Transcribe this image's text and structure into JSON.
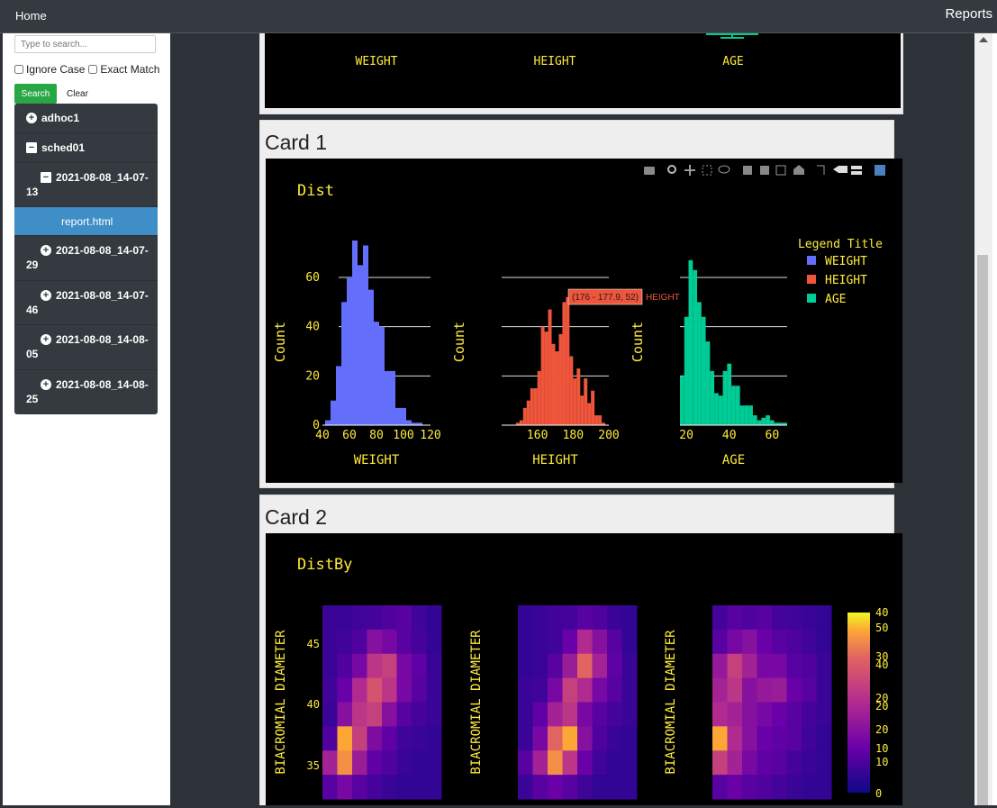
{
  "navbar": {
    "home": "Home",
    "reports": "Reports"
  },
  "sidebar": {
    "search_placeholder": "Type to search...",
    "ignore_case": "Ignore Case",
    "exact_match": "Exact Match",
    "search_button": "Search",
    "clear_button": "Clear",
    "tree": [
      {
        "label": "adhoc1",
        "icon": "plus-circle-icon"
      },
      {
        "label": "sched01",
        "icon": "minus-square-icon"
      },
      {
        "label": "2021-08-08_14-07-13",
        "icon": "minus-square-icon"
      },
      {
        "label": "report.html",
        "active": true
      },
      {
        "label": "2021-08-08_14-07-29",
        "icon": "plus-circle-icon"
      },
      {
        "label": "2021-08-08_14-07-46",
        "icon": "plus-circle-icon"
      },
      {
        "label": "2021-08-08_14-08-05",
        "icon": "plus-circle-icon"
      },
      {
        "label": "2021-08-08_14-08-25",
        "icon": "plus-circle-icon"
      }
    ]
  },
  "card0": {
    "labels": [
      "WEIGHT",
      "HEIGHT",
      "AGE"
    ]
  },
  "card1": {
    "title": "Card 1",
    "plot_title": "Dist",
    "legend_title": "Legend Title",
    "legend": [
      {
        "name": "WEIGHT",
        "color": "#636efa"
      },
      {
        "name": "HEIGHT",
        "color": "#ef553b"
      },
      {
        "name": "AGE",
        "color": "#00cc96"
      }
    ],
    "ylabel": "Count",
    "tooltip": "(176 - 177.9, 52)",
    "tooltip_series": "HEIGHT"
  },
  "card2": {
    "title": "Card 2",
    "plot_title": "DistBy",
    "ylabel": "BIACROMIAL DIAMETER",
    "yticks": [
      "45",
      "40",
      "35"
    ],
    "colorbar_labels": [
      "40",
      "50",
      "30",
      "40",
      "20",
      "20",
      "20",
      "10",
      "10",
      "0"
    ]
  },
  "chart_data": [
    {
      "type": "bar",
      "title": "Dist",
      "legend_title": "Legend Title",
      "legend_placement": "top-right",
      "ylabel": "Count",
      "ylim": [
        0,
        75
      ],
      "yticks": [
        0,
        20,
        40,
        60
      ],
      "panels": [
        {
          "name": "WEIGHT",
          "xlabel": "WEIGHT",
          "color": "#636efa",
          "xlim": [
            40,
            120
          ],
          "xticks": [
            40,
            60,
            80,
            100,
            120
          ],
          "bin_width": 4,
          "bin_starts": [
            42,
            46,
            50,
            54,
            58,
            62,
            66,
            70,
            74,
            78,
            82,
            86,
            90,
            94,
            98,
            102,
            106,
            110
          ],
          "values": [
            2,
            10,
            24,
            50,
            60,
            75,
            65,
            73,
            55,
            42,
            40,
            22,
            22,
            7,
            7,
            2,
            1,
            1
          ]
        },
        {
          "name": "HEIGHT",
          "xlabel": "HEIGHT",
          "color": "#ef553b",
          "xlim": [
            140,
            200
          ],
          "xticks": [
            160,
            180,
            200
          ],
          "bin_width": 2,
          "bin_starts": [
            148,
            150,
            152,
            154,
            156,
            158,
            160,
            162,
            164,
            166,
            168,
            170,
            172,
            174,
            176,
            178,
            180,
            182,
            184,
            186,
            188,
            190,
            192,
            194,
            196
          ],
          "values": [
            1,
            2,
            7,
            10,
            15,
            15,
            22,
            40,
            38,
            47,
            33,
            30,
            37,
            50,
            52,
            28,
            19,
            23,
            12,
            19,
            9,
            14,
            4,
            4,
            1
          ]
        },
        {
          "name": "AGE",
          "xlabel": "AGE",
          "color": "#00cc96",
          "xlim": [
            17,
            67
          ],
          "xticks": [
            20,
            40,
            60
          ],
          "bin_width": 2,
          "bin_starts": [
            17,
            19,
            21,
            23,
            25,
            27,
            29,
            31,
            33,
            35,
            37,
            39,
            41,
            43,
            45,
            47,
            49,
            51,
            53,
            55,
            57,
            59,
            61,
            63,
            65
          ],
          "values": [
            20,
            44,
            67,
            63,
            50,
            44,
            34,
            22,
            13,
            12,
            22,
            25,
            16,
            16,
            8,
            8,
            8,
            4,
            2,
            3,
            4,
            2,
            1,
            1,
            1
          ]
        }
      ]
    },
    {
      "type": "heatmap",
      "title": "DistBy",
      "ylabel": "BIACROMIAL DIAMETER",
      "colorscale": "plasma",
      "panels": [
        {
          "grid": [
            [
              0.12,
              0.12,
              0.14,
              0.15,
              0.18,
              0.2,
              0.14,
              0.1
            ],
            [
              0.12,
              0.14,
              0.18,
              0.35,
              0.3,
              0.2,
              0.15,
              0.1
            ],
            [
              0.12,
              0.18,
              0.3,
              0.55,
              0.6,
              0.3,
              0.22,
              0.12
            ],
            [
              0.14,
              0.25,
              0.5,
              0.68,
              0.55,
              0.3,
              0.2,
              0.12
            ],
            [
              0.12,
              0.35,
              0.55,
              0.6,
              0.35,
              0.2,
              0.15,
              0.12
            ],
            [
              0.18,
              0.9,
              0.6,
              0.32,
              0.22,
              0.14,
              0.12,
              0.1
            ],
            [
              0.45,
              0.85,
              0.42,
              0.22,
              0.18,
              0.12,
              0.1,
              0.1
            ],
            [
              0.2,
              0.3,
              0.2,
              0.15,
              0.12,
              0.1,
              0.1,
              0.1
            ]
          ]
        },
        {
          "grid": [
            [
              0.1,
              0.12,
              0.14,
              0.15,
              0.2,
              0.18,
              0.12,
              0.1
            ],
            [
              0.1,
              0.12,
              0.14,
              0.25,
              0.5,
              0.35,
              0.2,
              0.1
            ],
            [
              0.1,
              0.12,
              0.2,
              0.42,
              0.75,
              0.45,
              0.22,
              0.12
            ],
            [
              0.12,
              0.14,
              0.3,
              0.6,
              0.5,
              0.3,
              0.2,
              0.12
            ],
            [
              0.12,
              0.22,
              0.45,
              0.55,
              0.3,
              0.2,
              0.15,
              0.12
            ],
            [
              0.12,
              0.3,
              0.75,
              0.9,
              0.35,
              0.18,
              0.12,
              0.1
            ],
            [
              0.2,
              0.45,
              0.85,
              0.55,
              0.25,
              0.14,
              0.1,
              0.1
            ],
            [
              0.12,
              0.2,
              0.25,
              0.2,
              0.14,
              0.1,
              0.1,
              0.1
            ]
          ]
        },
        {
          "grid": [
            [
              0.15,
              0.2,
              0.18,
              0.2,
              0.15,
              0.14,
              0.12,
              0.1
            ],
            [
              0.2,
              0.3,
              0.35,
              0.25,
              0.2,
              0.18,
              0.14,
              0.1
            ],
            [
              0.4,
              0.6,
              0.45,
              0.3,
              0.3,
              0.2,
              0.18,
              0.12
            ],
            [
              0.45,
              0.55,
              0.35,
              0.4,
              0.42,
              0.25,
              0.2,
              0.12
            ],
            [
              0.5,
              0.45,
              0.35,
              0.3,
              0.25,
              0.2,
              0.15,
              0.12
            ],
            [
              0.9,
              0.5,
              0.35,
              0.25,
              0.22,
              0.2,
              0.14,
              0.1
            ],
            [
              0.6,
              0.45,
              0.3,
              0.22,
              0.2,
              0.15,
              0.12,
              0.1
            ],
            [
              0.2,
              0.25,
              0.2,
              0.18,
              0.15,
              0.12,
              0.1,
              0.1
            ]
          ]
        }
      ]
    }
  ]
}
